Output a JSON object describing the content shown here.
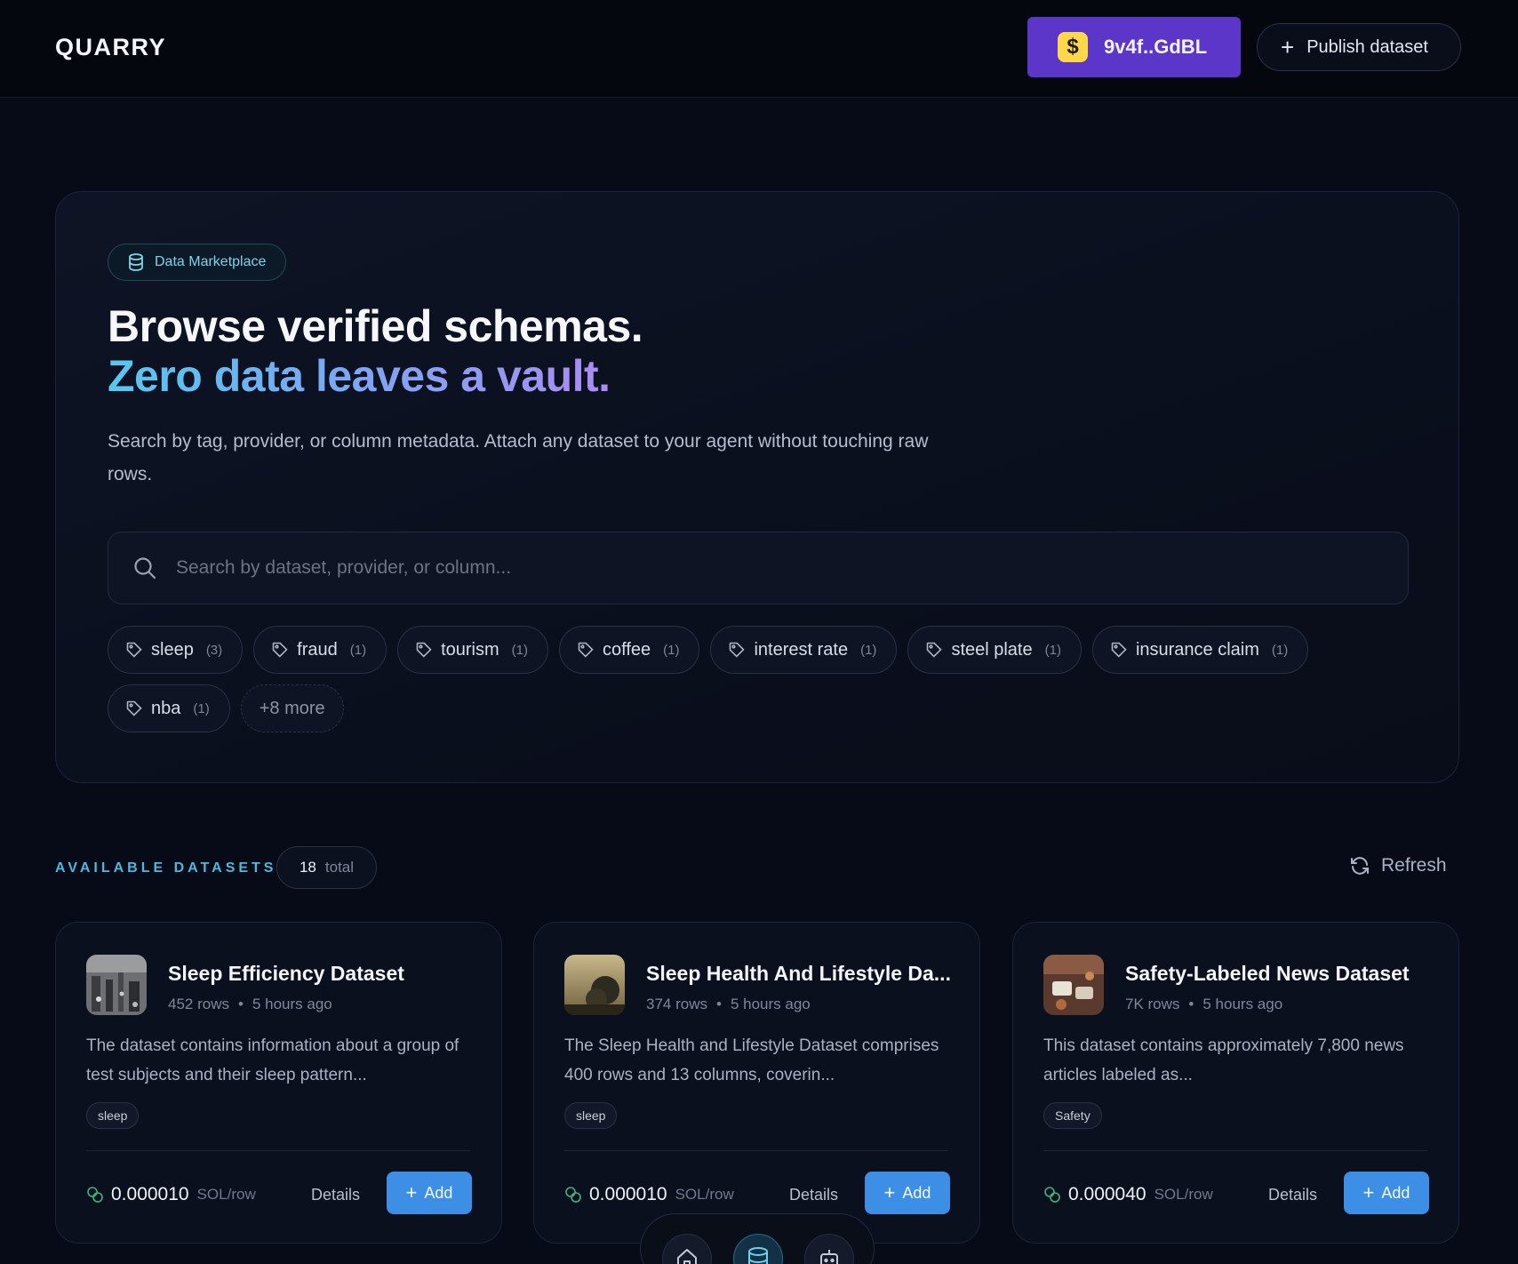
{
  "header": {
    "brand": "QUARRY",
    "wallet_address": "9v4f..GdBL",
    "publish_label": "Publish dataset"
  },
  "hero": {
    "badge": "Data Marketplace",
    "title_line1": "Browse verified schemas.",
    "title_line2": "Zero data leaves a vault.",
    "subtitle": "Search by tag, provider, or column metadata. Attach any dataset to your agent without touching raw rows.",
    "search_placeholder": "Search by dataset, provider, or column...",
    "tags": [
      {
        "label": "sleep",
        "count": "(3)"
      },
      {
        "label": "fraud",
        "count": "(1)"
      },
      {
        "label": "tourism",
        "count": "(1)"
      },
      {
        "label": "coffee",
        "count": "(1)"
      },
      {
        "label": "interest rate",
        "count": "(1)"
      },
      {
        "label": "steel plate",
        "count": "(1)"
      },
      {
        "label": "insurance claim",
        "count": "(1)"
      },
      {
        "label": "nba",
        "count": "(1)"
      }
    ],
    "more_label": "+8 more"
  },
  "datasets": {
    "section_label": "AVAILABLE DATASETS",
    "total_count": "18",
    "total_label": "total",
    "refresh_label": "Refresh",
    "details_label": "Details",
    "add_label": "Add",
    "price_unit": "SOL/row",
    "cards": [
      {
        "title": "Sleep Efficiency Dataset",
        "rows": "452 rows",
        "updated": "5 hours ago",
        "description": "The dataset contains information about a group of test subjects and their sleep pattern...",
        "tag": "sleep",
        "price": "0.000010"
      },
      {
        "title": "Sleep Health And Lifestyle Da...",
        "rows": "374 rows",
        "updated": "5 hours ago",
        "description": "The Sleep Health and Lifestyle Dataset comprises 400 rows and 13 columns, coverin...",
        "tag": "sleep",
        "price": "0.000010"
      },
      {
        "title": "Safety-Labeled News Dataset",
        "rows": "7K rows",
        "updated": "5 hours ago",
        "description": "This dataset contains approximately 7,800 news articles labeled as...",
        "tag": "Safety",
        "price": "0.000040"
      }
    ]
  },
  "colors": {
    "accent_wallet": "#5b36c9",
    "accent_add": "#3d8fe6",
    "accent_cyan": "#4fb8d9"
  },
  "icons": [
    "database-icon",
    "search-icon",
    "tag-icon",
    "refresh-icon",
    "coins-icon",
    "plus-icon",
    "home-icon",
    "bot-icon"
  ]
}
